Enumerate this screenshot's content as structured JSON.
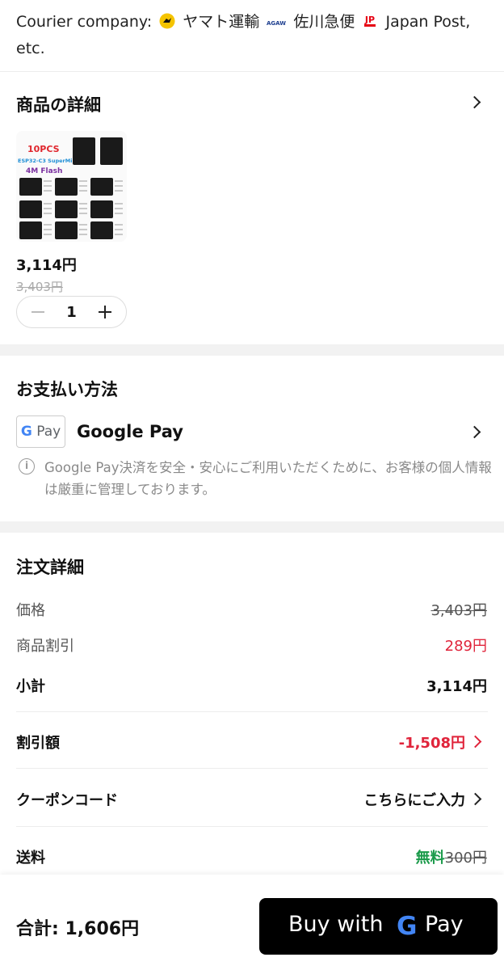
{
  "shipping": {
    "courier_prefix": "Courier company:",
    "carrier_yamato": "ヤマト運輸",
    "carrier_sagawa": "佐川急便",
    "carrier_jp": "Japan Post,",
    "suffix": "etc.",
    "sagawa_logo_text": "SAGAWA",
    "jp_logo_text": "JP"
  },
  "product": {
    "section_title": "商品の詳細",
    "image_text": {
      "line1": "10PCS",
      "line2": "ESP32-C3 SuperMini",
      "line3": "4M Flash"
    },
    "price": "3,114円",
    "original_price": "3,403円",
    "quantity": "1"
  },
  "payment": {
    "section_title": "お支払い方法",
    "method_logo_g": "G",
    "method_logo_pay": "Pay",
    "method_name": "Google Pay",
    "info_icon": "i",
    "info_text": "Google Pay決済を安全・安心にご利用いただくために、お客様の個人情報は厳重に管理しております。"
  },
  "order": {
    "section_title": "注文詳細",
    "rows": [
      {
        "label": "価格",
        "value": "3,403円"
      },
      {
        "label": "商品割引",
        "value": "289円"
      },
      {
        "label": "小計",
        "value": "3,114円"
      },
      {
        "label": "割引額",
        "value": "-1,508円"
      },
      {
        "label": "クーポンコード",
        "value": "こちらにご入力"
      }
    ],
    "shipping_label": "送料",
    "shipping_free": "無料",
    "shipping_old": "300円"
  },
  "footer": {
    "total_label": "合計:",
    "total_value": "1,606円",
    "buy_text": "Buy with",
    "buy_g": "G",
    "buy_pay": "Pay"
  },
  "colors": {
    "discount_red": "#e0243b",
    "free_green": "#1a9a4a",
    "button_bg": "#000000"
  }
}
